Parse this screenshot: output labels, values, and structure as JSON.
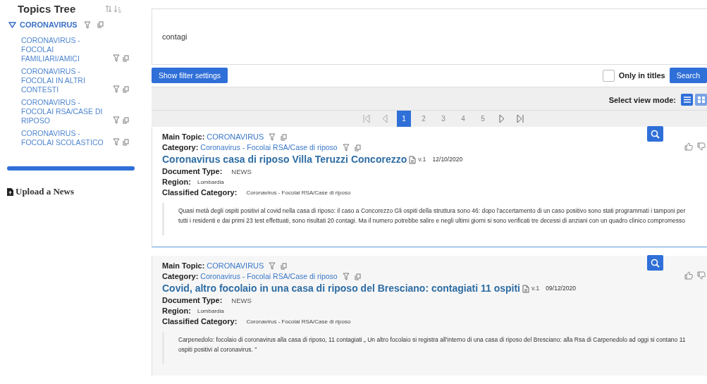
{
  "sidebar": {
    "title": "Topics Tree",
    "tree": [
      {
        "label": "CORONAVIRUS",
        "expanded": true,
        "children": [
          {
            "label": "CORONAVIRUS - FOCOLAI FAMILIARI/AMICI"
          },
          {
            "label": "CORONAVIRUS - FOCOLAI IN ALTRI CONTESTI"
          },
          {
            "label": "CORONAVIRUS - FOCOLAI RSA/CASE DI RIPOSO"
          },
          {
            "label": "CORONAVIRUS - FOCOLAI SCOLASTICO"
          }
        ]
      }
    ],
    "progress": {
      "level": 1
    },
    "upload_link": "Upload a News"
  },
  "search": {
    "value": "contagi",
    "filter_button": "Show filter settings",
    "only_in_titles": {
      "label": "Only in titles",
      "checked": false
    },
    "search_button": "Search"
  },
  "view_mode": {
    "label": "Select view mode:",
    "modes": [
      {
        "selected": true
      },
      {
        "selected": false
      }
    ]
  },
  "pagination": {
    "pages": [
      {
        "label": "1",
        "selected": true
      },
      {
        "label": "2",
        "selected": false
      },
      {
        "label": "3",
        "selected": false
      },
      {
        "label": "4",
        "selected": false
      },
      {
        "label": "5",
        "selected": false
      }
    ]
  },
  "results": [
    {
      "highlighted": false,
      "main_topic_label": "Main Topic:",
      "main_topic": "CORONAVIRUS",
      "category_label": "Category:",
      "category": "Coronavirus - Focolai RSA/Case di riposo",
      "title": "Coronavirus casa di riposo Villa Teruzzi Concorezzo",
      "version": "v.1",
      "date": "12/10/2020",
      "doc_type_label": "Document Type:",
      "doc_type": "NEWS",
      "region_label": "Region:",
      "region": "Lombardia",
      "classified_label": "Classified Category:",
      "classified": "Coronavirus - Focolai RSA/Case di riposo",
      "abstract": "Quasi metà degli ospiti positivi al covid nella casa di riposo: il caso a Concorezzo Gli ospiti della struttura sono 46: dopo l'accertamento di un caso positivo sono stati programmati i tamponi per tutti i residenti e dai primi 23 test effettuati, sono risultati 20 contagi. Ma il numero potrebbe salire e negli ultimi giorni si sono verificati tre decessi di anziani con un quadro clinico compromesso"
    },
    {
      "highlighted": true,
      "main_topic_label": "Main Topic:",
      "main_topic": "CORONAVIRUS",
      "category_label": "Category:",
      "category": "Coronavirus - Focolai RSA/Case di riposo",
      "title": "Covid, altro focolaio in una casa di riposo del Bresciano: contagiati 11 ospiti",
      "version": "v.1",
      "date": "09/12/2020",
      "doc_type_label": "Document Type:",
      "doc_type": "NEWS",
      "region_label": "Region:",
      "region": "Lombardia",
      "classified_label": "Classified Category:",
      "classified": "Coronavirus - Focolai RSA/Case di riposo",
      "abstract": "Carpenedolo: focolaio di coronavirus alla casa di riposo, 11 contagiati „ Un altro focolaio si registra all'interno di una casa di riposo del Bresciano: alla Rsa di Carpenedolo ad oggi si contano 11 ospiti positivi al coronavirus. \""
    }
  ]
}
